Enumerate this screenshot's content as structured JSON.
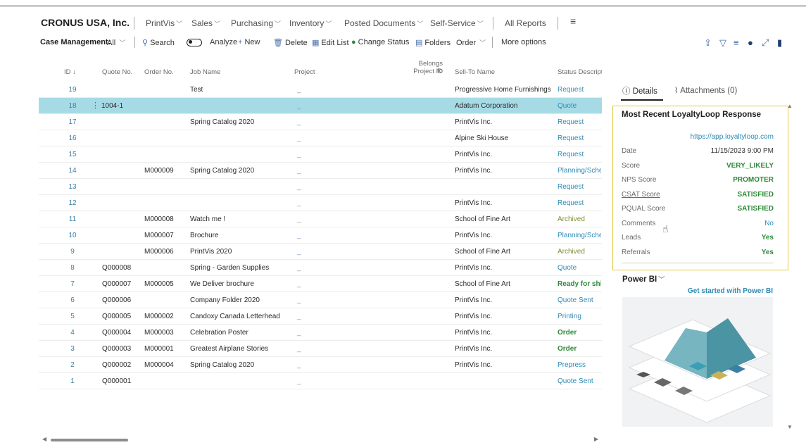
{
  "company": "CRONUS USA, Inc.",
  "nav": [
    {
      "label": "PrintVis",
      "chevron": true
    },
    {
      "label": "Sales",
      "chevron": true
    },
    {
      "label": "Purchasing",
      "chevron": true
    },
    {
      "label": "Inventory",
      "chevron": true
    },
    {
      "label": "Posted Documents",
      "chevron": true
    },
    {
      "label": "Self-Service",
      "chevron": true
    },
    {
      "label": "All Reports",
      "chevron": false
    },
    {
      "label": "≡",
      "chevron": false
    }
  ],
  "actionbar": {
    "page_title": "Case Management:",
    "filter": "All",
    "search": "Search",
    "analyze": "Analyze",
    "new": "New",
    "delete": "Delete",
    "edit_list": "Edit List",
    "change_status": "Change Status",
    "folders": "Folders",
    "order": "Order",
    "more_options": "More options"
  },
  "table": {
    "headers": {
      "id": "ID ↓",
      "quote_no": "Quote No.",
      "order_no": "Order No.",
      "job_name": "Job Name",
      "project": "Project",
      "belongs_to_1": "Belongs to",
      "belongs_to_2": "Project ID",
      "sell_to_name": "Sell-To Name",
      "status": "Status Description"
    },
    "rows": [
      {
        "id": "19",
        "quote": "",
        "order": "",
        "job": "Test",
        "project": "_",
        "sell": "Progressive Home Furnishings",
        "status": "Request",
        "style": ""
      },
      {
        "id": "18",
        "quote": "1004-1",
        "order": "",
        "job": "",
        "project": "_",
        "sell": "Adatum Corporation",
        "status": "Quote",
        "style": "",
        "selected": true
      },
      {
        "id": "17",
        "quote": "",
        "order": "",
        "job": "Spring Catalog 2020",
        "project": "_",
        "sell": "PrintVis Inc.",
        "status": "Request",
        "style": ""
      },
      {
        "id": "16",
        "quote": "",
        "order": "",
        "job": "",
        "project": "_",
        "sell": "Alpine Ski House",
        "status": "Request",
        "style": ""
      },
      {
        "id": "15",
        "quote": "",
        "order": "",
        "job": "",
        "project": "_",
        "sell": "PrintVis Inc.",
        "status": "Request",
        "style": ""
      },
      {
        "id": "14",
        "quote": "",
        "order": "M000009",
        "job": "Spring Catalog 2020",
        "project": "_",
        "sell": "PrintVis Inc.",
        "status": "Planning/Sche",
        "style": ""
      },
      {
        "id": "13",
        "quote": "",
        "order": "",
        "job": "",
        "project": "_",
        "sell": "",
        "status": "Request",
        "style": ""
      },
      {
        "id": "12",
        "quote": "",
        "order": "",
        "job": "",
        "project": "_",
        "sell": "PrintVis Inc.",
        "status": "Request",
        "style": ""
      },
      {
        "id": "11",
        "quote": "",
        "order": "M000008",
        "job": "Watch me !",
        "project": "_",
        "sell": "School of Fine Art",
        "status": "Archived",
        "style": "archived"
      },
      {
        "id": "10",
        "quote": "",
        "order": "M000007",
        "job": "Brochure",
        "project": "_",
        "sell": "PrintVis Inc.",
        "status": "Planning/Sche",
        "style": ""
      },
      {
        "id": "9",
        "quote": "",
        "order": "M000006",
        "job": "PrintVis 2020",
        "project": "_",
        "sell": "School of Fine Art",
        "status": "Archived",
        "style": "archived"
      },
      {
        "id": "8",
        "quote": "Q000008",
        "order": "",
        "job": "Spring - Garden Supplies",
        "project": "_",
        "sell": "PrintVis Inc.",
        "status": "Quote",
        "style": ""
      },
      {
        "id": "7",
        "quote": "Q000007",
        "order": "M000005",
        "job": "We Deliver brochure",
        "project": "_",
        "sell": "School of Fine Art",
        "status": "Ready for ship",
        "style": "green"
      },
      {
        "id": "6",
        "quote": "Q000006",
        "order": "",
        "job": "Company Folder 2020",
        "project": "_",
        "sell": "PrintVis Inc.",
        "status": "Quote Sent",
        "style": ""
      },
      {
        "id": "5",
        "quote": "Q000005",
        "order": "M000002",
        "job": "Candoxy Canada Letterhead",
        "project": "_",
        "sell": "PrintVis Inc.",
        "status": "Printing",
        "style": ""
      },
      {
        "id": "4",
        "quote": "Q000004",
        "order": "M000003",
        "job": "Celebration Poster",
        "project": "_",
        "sell": "PrintVis Inc.",
        "status": "Order",
        "style": "green"
      },
      {
        "id": "3",
        "quote": "Q000003",
        "order": "M000001",
        "job": "Greatest Airplane Stories",
        "project": "_",
        "sell": "PrintVis Inc.",
        "status": "Order",
        "style": "green"
      },
      {
        "id": "2",
        "quote": "Q000002",
        "order": "M000004",
        "job": "Spring Catalog 2020",
        "project": "_",
        "sell": "PrintVis Inc.",
        "status": "Prepress",
        "style": ""
      },
      {
        "id": "1",
        "quote": "Q000001",
        "order": "",
        "job": "",
        "project": "_",
        "sell": "",
        "status": "Quote Sent",
        "style": ""
      }
    ]
  },
  "factbox": {
    "tab_details": "Details",
    "tab_attachments": "Attachments (0)",
    "card_title": "Most Recent LoyaltyLoop Response",
    "link": "https://app.loyaltyloop.com",
    "fields": [
      {
        "label": "Date",
        "value": "11/15/2023 9:00 PM",
        "style": ""
      },
      {
        "label": "Score",
        "value": "VERY_LIKELY",
        "style": "green"
      },
      {
        "label": "NPS Score",
        "value": "PROMOTER",
        "style": "green"
      },
      {
        "label": "CSAT Score",
        "value": "SATISFIED",
        "style": "green",
        "link": true
      },
      {
        "label": "PQUAL Score",
        "value": "SATISFIED",
        "style": "green"
      },
      {
        "label": "Comments",
        "value": "No",
        "style": "blue"
      },
      {
        "label": "Leads",
        "value": "Yes",
        "style": "green"
      },
      {
        "label": "Referrals",
        "value": "Yes",
        "style": "green"
      }
    ],
    "powerbi_title": "Power BI",
    "powerbi_link": "Get started with Power BI"
  },
  "colors": {
    "selected_row": "#a6dbe6",
    "accent": "#2e8bb5",
    "green": "#2f8a3a",
    "card_border": "#e3c840"
  }
}
